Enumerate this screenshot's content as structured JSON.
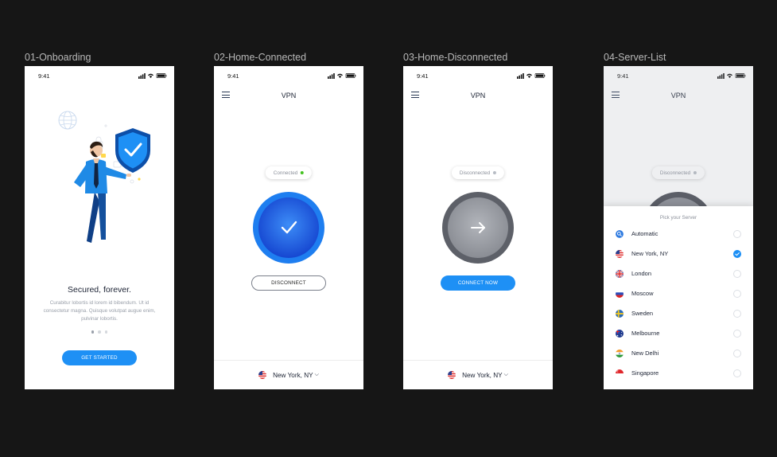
{
  "screens": {
    "onboarding": {
      "label": "01-Onboarding",
      "time": "9:41",
      "title": "Secured, forever.",
      "body": "Curabitur lobortis id lorem id bibendum. Ut id consectetur magna. Quisque volutpat augue enim, pulvinar lobortis.",
      "cta": "GET STARTED",
      "page_index": 1,
      "page_count": 3
    },
    "home_connected": {
      "label": "02-Home-Connected",
      "time": "9:41",
      "title": "VPN",
      "status": "Connected",
      "button": "DISCONNECT",
      "location": "New York, NY"
    },
    "home_disconnected": {
      "label": "03-Home-Disconnected",
      "time": "9:41",
      "title": "VPN",
      "status": "Disconnected",
      "button": "CONNECT NOW",
      "location": "New York, NY"
    },
    "server_list": {
      "label": "04-Server-List",
      "time": "9:41",
      "title": "VPN",
      "status": "Disconnected",
      "sheet_title": "Pick your Server",
      "servers": [
        {
          "name": "Automatic",
          "flag": "automatic-icon",
          "selected": false
        },
        {
          "name": "New York, NY",
          "flag": "us-flag-icon",
          "selected": true
        },
        {
          "name": "London",
          "flag": "uk-flag-icon",
          "selected": false
        },
        {
          "name": "Moscow",
          "flag": "russia-flag-icon",
          "selected": false
        },
        {
          "name": "Sweden",
          "flag": "sweden-flag-icon",
          "selected": false
        },
        {
          "name": "Melbourne",
          "flag": "australia-flag-icon",
          "selected": false
        },
        {
          "name": "New Delhi",
          "flag": "india-flag-icon",
          "selected": false
        },
        {
          "name": "Singapore",
          "flag": "singapore-flag-icon",
          "selected": false
        }
      ]
    }
  },
  "colors": {
    "background": "#161616",
    "accent": "#1e90f5",
    "connected_dot": "#43c21f",
    "disconnected_dot": "#b7bcc4",
    "connected_circle": "#1f6ee8",
    "disconnected_circle": "#7c7f87",
    "text_dark": "#1b2233"
  }
}
